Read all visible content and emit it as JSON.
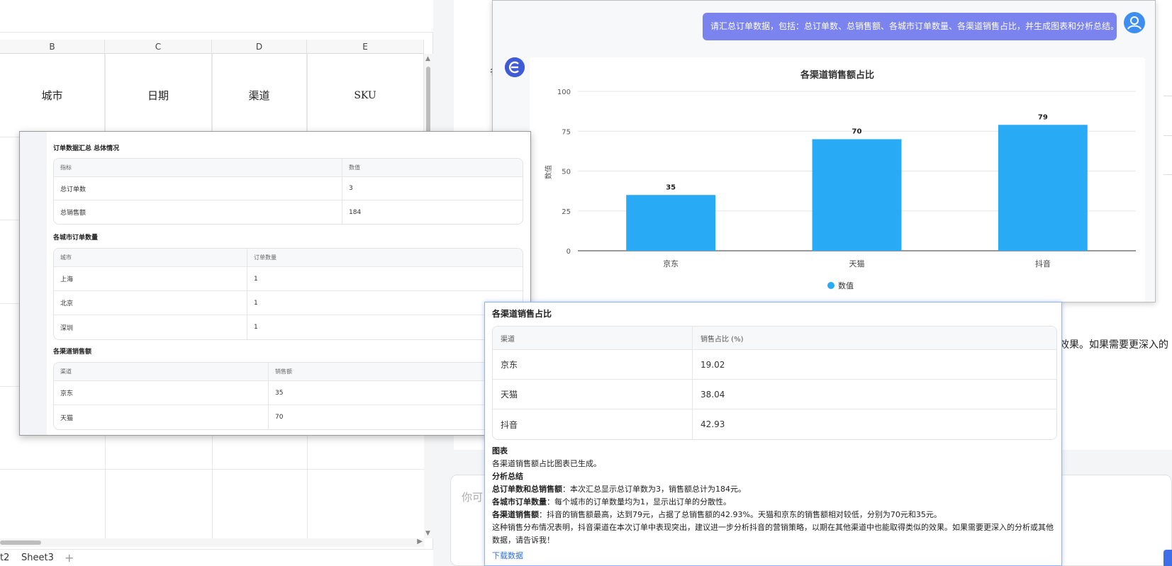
{
  "spreadsheet": {
    "columns": [
      "B",
      "C",
      "D",
      "E"
    ],
    "headers": [
      "城市",
      "日期",
      "渠道",
      "SKU"
    ],
    "sheet_tabs": [
      "t2",
      "Sheet3"
    ]
  },
  "chat": {
    "user_message": "请汇总订单数据，包括：总订单数、总销售额、各城市订单数量、各渠道销售占比，并生成图表和分析总结。",
    "background_text": "效果。如果需要更深入的",
    "background_char": "各",
    "input_placeholder": "你可"
  },
  "chart_data": {
    "type": "bar",
    "title": "各渠道销售额占比",
    "categories": [
      "京东",
      "天猫",
      "抖音"
    ],
    "series": [
      {
        "name": "数值",
        "values": [
          35,
          70,
          79
        ]
      }
    ],
    "ylabel": "数值",
    "xlabel": "",
    "ylim": [
      0,
      100
    ],
    "yticks": [
      0,
      25,
      50,
      75,
      100
    ],
    "grid": true,
    "legend": "bottom",
    "color": "#29aaf5"
  },
  "summary": {
    "title": "订单数据汇总 总体情况",
    "overall": {
      "headers": [
        "指标",
        "数值"
      ],
      "rows": [
        [
          "总订单数",
          "3"
        ],
        [
          "总销售额",
          "184"
        ]
      ]
    },
    "city_title": "各城市订单数量",
    "city": {
      "headers": [
        "城市",
        "订单数量"
      ],
      "rows": [
        [
          "上海",
          "1"
        ],
        [
          "北京",
          "1"
        ],
        [
          "深圳",
          "1"
        ]
      ]
    },
    "channel_title": "各渠道销售额",
    "channel": {
      "headers": [
        "渠道",
        "销售额"
      ],
      "rows": [
        [
          "京东",
          "35"
        ],
        [
          "天猫",
          "70"
        ]
      ]
    }
  },
  "share": {
    "title": "各渠道销售占比",
    "headers": [
      "渠道",
      "销售占比 (%)"
    ],
    "rows": [
      [
        "京东",
        "19.02"
      ],
      [
        "天猫",
        "38.04"
      ],
      [
        "抖音",
        "42.93"
      ]
    ],
    "chart_heading": "图表",
    "chart_note": "各渠道销售额占比图表已生成。",
    "analysis_heading": "分析总结",
    "points": [
      {
        "label": "总订单数和总销售额",
        "text": "：本次汇总显示总订单数为3，销售额总计为184元。"
      },
      {
        "label": "各城市订单数量",
        "text": "：每个城市的订单数量均为1，显示出订单的分散性。"
      },
      {
        "label": "各渠道销售额",
        "text": "：抖音的销售额最高，达到79元，占据了总销售额的42.93%。天猫和京东的销售额相对较低，分别为70元和35元。"
      }
    ],
    "conclusion": "这种销售分布情况表明，抖音渠道在本次订单中表现突出，建议进一步分析抖音的营销策略，以期在其他渠道中也能取得类似的效果。如果需要更深入的分析或其他数据，请告诉我！",
    "download_link": "下载数据"
  }
}
